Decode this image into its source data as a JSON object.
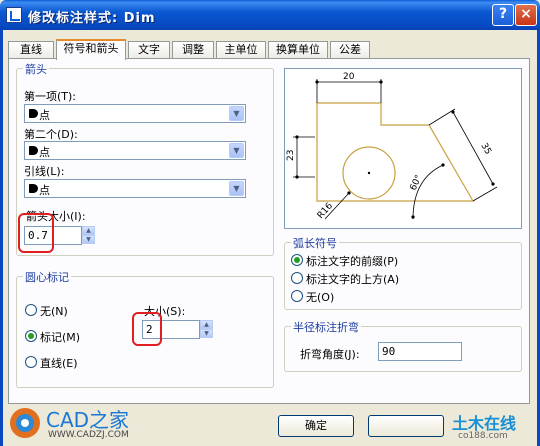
{
  "window": {
    "title": "修改标注样式: Dim",
    "help_label": "?",
    "close_label": "×"
  },
  "tabs": [
    {
      "label": "直线"
    },
    {
      "label": "符号和箭头"
    },
    {
      "label": "文字"
    },
    {
      "label": "调整"
    },
    {
      "label": "主单位"
    },
    {
      "label": "换算单位"
    },
    {
      "label": "公差"
    }
  ],
  "arrows": {
    "group_title": "箭头",
    "first_label": "第一项(T):",
    "first_value": "点",
    "second_label": "第二个(D):",
    "second_value": "点",
    "leader_label": "引线(L):",
    "leader_value": "点",
    "size_label": "箭头大小(I):",
    "size_value": "0.7"
  },
  "center_marks": {
    "group_title": "圆心标记",
    "options": [
      {
        "label": "无(N)",
        "selected": false
      },
      {
        "label": "标记(M)",
        "selected": true
      },
      {
        "label": "直线(E)",
        "selected": false
      }
    ],
    "size_label": "大小(S):",
    "size_value": "2"
  },
  "preview": {
    "dim_top": "20",
    "dim_left": "23",
    "dim_right": "35",
    "dim_angle": "60°",
    "dim_radius": "R16"
  },
  "arc_symbol": {
    "group_title": "弧长符号",
    "options": [
      {
        "label": "标注文字的前缀(P)",
        "selected": true
      },
      {
        "label": "标注文字的上方(A)",
        "selected": false
      },
      {
        "label": "无(O)",
        "selected": false
      }
    ]
  },
  "radius_jog": {
    "group_title": "半径标注折弯",
    "angle_label": "折弯角度(J):",
    "angle_value": "90"
  },
  "buttons": {
    "ok": "确定"
  },
  "watermark": {
    "left_name": "CAD之家",
    "left_url": "WWW.CADZJ.COM",
    "right_name": "土木在线",
    "right_url": "co188.com"
  },
  "colors": {
    "titlebar": "#0a5fd8",
    "group_title": "#1e3c9e",
    "highlight": "#e02020",
    "preview_shape": "#c8a040"
  }
}
